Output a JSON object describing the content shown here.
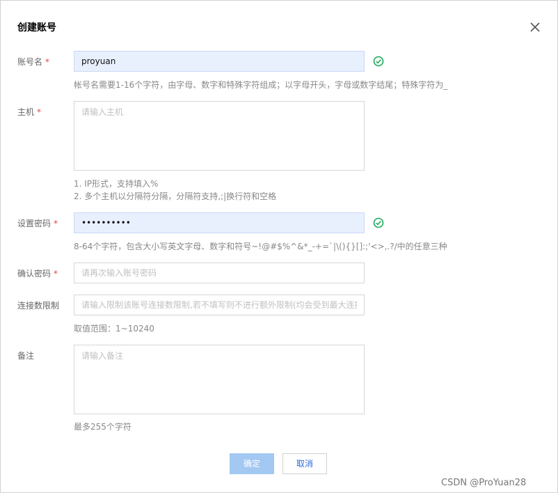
{
  "dialog": {
    "title": "创建账号"
  },
  "form": {
    "account_name": {
      "label": "账号名",
      "required_mark": "*",
      "value": "proyuan",
      "hint": "帐号名需要1-16个字符，由字母、数字和特殊字符组成；以字母开头，字母或数字结尾；特殊字符为_"
    },
    "host": {
      "label": "主机",
      "required_mark": "*",
      "placeholder": "请输入主机",
      "hints": [
        "1. IP形式，支持填入%",
        "2. 多个主机以分隔符分隔，分隔符支持,;|换行符和空格"
      ]
    },
    "password": {
      "label": "设置密码",
      "required_mark": "*",
      "value": "1234567890",
      "hint": "8-64个字符，包含大小写英文字母、数字和符号~!@#$%^&*_-+=`|\\(){}[]:;'<>,.?/中的任意三种"
    },
    "confirm_password": {
      "label": "确认密码",
      "required_mark": "*",
      "placeholder": "请再次输入账号密码"
    },
    "connection_limit": {
      "label": "连接数限制",
      "placeholder": "请输入限制该账号连接数限制,若不填写则不进行额外限制(均会受到最大连接",
      "hint": "取值范围：1~10240"
    },
    "remarks": {
      "label": "备注",
      "placeholder": "请输入备注",
      "hint": "最多255个字符"
    }
  },
  "buttons": {
    "confirm": "确定",
    "cancel": "取消"
  },
  "watermark": "CSDN @ProYuan28",
  "colors": {
    "valid": "#1aab5b",
    "required": "#e54545",
    "primary_disabled": "#a3c8f2",
    "link": "#2b68d9"
  }
}
